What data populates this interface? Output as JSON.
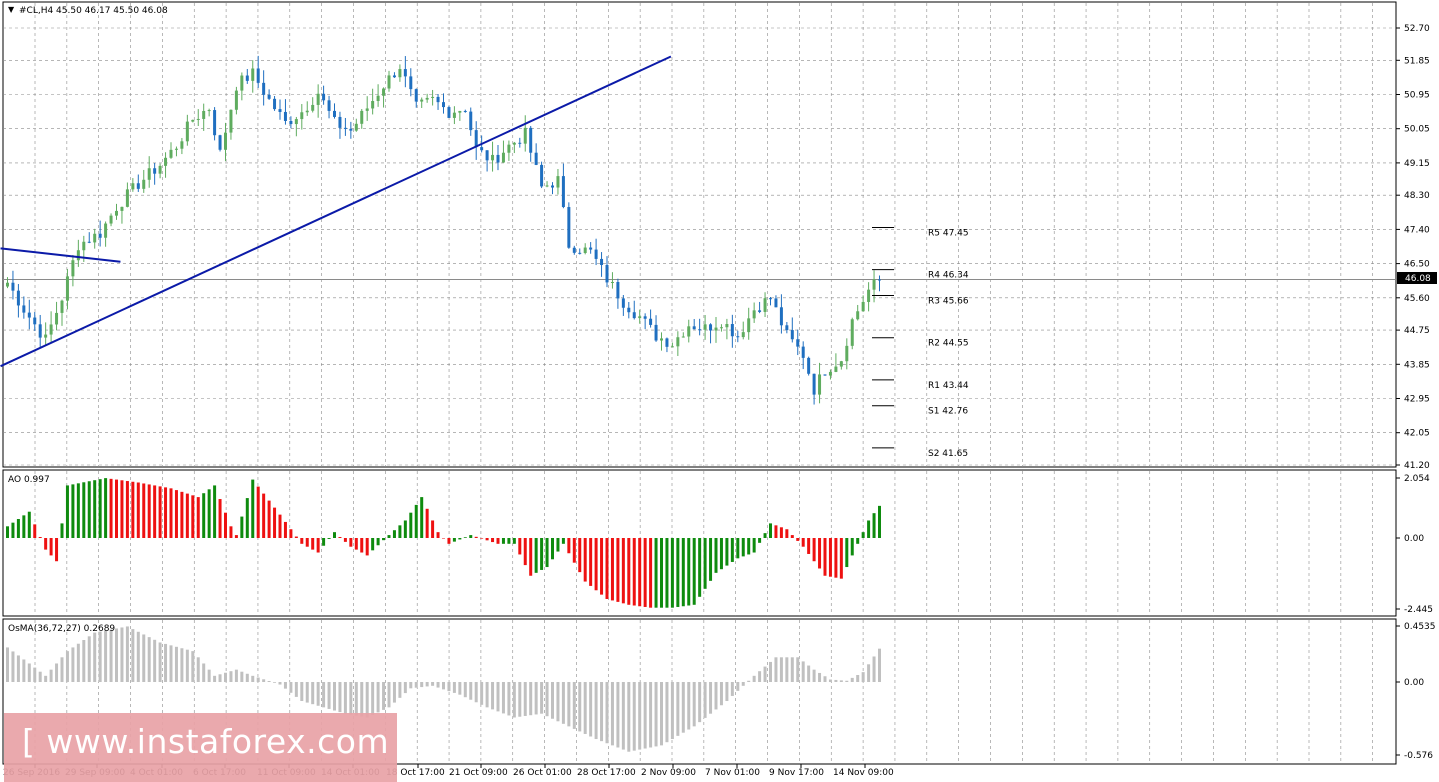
{
  "header": {
    "symbol_line": "#CL,H4  45.50 46.17 45.50 46.08",
    "symbol": "#CL,H4",
    "ohlc": "45.50 46.17 45.50 46.08"
  },
  "colors": {
    "bull": "#5fac5f",
    "bear": "#1f6fc0",
    "trendline": "#0b1aa8",
    "grid": "#8a8a8a",
    "ao_up": "#0e8b0e",
    "ao_down": "#ee1111",
    "osma": "#c0c0c0",
    "watermark_bg": "#e8a2a6"
  },
  "price_axis": {
    "labels": [
      "52.70",
      "51.85",
      "50.95",
      "50.05",
      "49.15",
      "48.30",
      "47.40",
      "46.50",
      "45.60",
      "44.75",
      "43.85",
      "42.95",
      "42.05",
      "41.20"
    ],
    "current_price": "46.08"
  },
  "pivot_levels": [
    {
      "label": "R5 47.45",
      "value": 47.45
    },
    {
      "label": "R4 46.34",
      "value": 46.34
    },
    {
      "label": "R3 45.66",
      "value": 45.66
    },
    {
      "label": "R2 44.55",
      "value": 44.55
    },
    {
      "label": "R1 43.44",
      "value": 43.44
    },
    {
      "label": "S1 42.76",
      "value": 42.76
    },
    {
      "label": "S2 41.65",
      "value": 41.65
    }
  ],
  "time_axis": {
    "labels": [
      "26 Sep 2016",
      "29 Sep 09:00",
      "4 Oct 01:00",
      "6 Oct 17:00",
      "11 Oct 09:00",
      "14 Oct 01:00",
      "18 Oct 17:00",
      "21 Oct 09:00",
      "26 Oct 01:00",
      "28 Oct 17:00",
      "2 Nov 09:00",
      "7 Nov 01:00",
      "9 Nov 17:00",
      "14 Nov 09:00"
    ]
  },
  "ao": {
    "title": "AO 0.997",
    "labels": [
      "2.054",
      "0.00",
      "-2.445"
    ],
    "max": 2.054,
    "min": -2.445
  },
  "osma": {
    "title": "OsMA(36,72,27) 0.2689",
    "labels": [
      "0.4535",
      "0.00",
      "-0.576"
    ],
    "max": 0.4535,
    "min": -0.576
  },
  "watermark": {
    "text": "[ www.instaforex.com ]"
  },
  "chart_data": [
    {
      "type": "candlestick",
      "title": "#CL,H4  45.50 46.17 45.50 46.08",
      "ylim": [
        41.2,
        52.7
      ],
      "x_ticks": [
        "26 Sep 2016",
        "29 Sep 09:00",
        "4 Oct 01:00",
        "6 Oct 17:00",
        "11 Oct 09:00",
        "14 Oct 01:00",
        "18 Oct 17:00",
        "21 Oct 09:00",
        "26 Oct 01:00",
        "28 Oct 17:00",
        "2 Nov 09:00",
        "7 Nov 01:00",
        "9 Nov 17:00",
        "14 Nov 09:00"
      ],
      "close_path": [
        [
          0,
          46.0
        ],
        [
          3,
          45.3
        ],
        [
          7,
          44.5
        ],
        [
          10,
          45.6
        ],
        [
          13,
          47.0
        ],
        [
          17,
          47.3
        ],
        [
          20,
          48.0
        ],
        [
          24,
          48.6
        ],
        [
          28,
          49.1
        ],
        [
          31,
          49.6
        ],
        [
          34,
          50.3
        ],
        [
          37,
          50.6
        ],
        [
          39,
          49.4
        ],
        [
          42,
          51.2
        ],
        [
          45,
          51.5
        ],
        [
          48,
          50.8
        ],
        [
          51,
          50.2
        ],
        [
          54,
          50.5
        ],
        [
          57,
          51.0
        ],
        [
          60,
          50.2
        ],
        [
          63,
          50.0
        ],
        [
          66,
          50.6
        ],
        [
          69,
          51.2
        ],
        [
          72,
          51.7
        ],
        [
          75,
          50.6
        ],
        [
          78,
          50.8
        ],
        [
          81,
          50.5
        ],
        [
          84,
          50.6
        ],
        [
          86,
          49.5
        ],
        [
          89,
          49.2
        ],
        [
          92,
          49.6
        ],
        [
          95,
          49.9
        ],
        [
          98,
          48.5
        ],
        [
          101,
          48.7
        ],
        [
          103,
          47.0
        ],
        [
          107,
          46.8
        ],
        [
          110,
          46.1
        ],
        [
          113,
          45.5
        ],
        [
          116,
          45.1
        ],
        [
          119,
          44.6
        ],
        [
          122,
          44.4
        ],
        [
          125,
          44.9
        ],
        [
          128,
          44.8
        ],
        [
          131,
          45.0
        ],
        [
          134,
          44.6
        ],
        [
          137,
          45.3
        ],
        [
          140,
          45.6
        ],
        [
          143,
          44.6
        ],
        [
          146,
          44.1
        ],
        [
          148,
          43.2
        ],
        [
          150,
          43.7
        ],
        [
          153,
          44.0
        ],
        [
          155,
          45.0
        ],
        [
          158,
          45.8
        ],
        [
          160,
          46.08
        ]
      ],
      "trendlines": [
        {
          "from": [
            -1,
            43.8
          ],
          "to": [
            122,
            51.95
          ]
        },
        {
          "from": [
            -1,
            46.9
          ],
          "to": [
            21,
            46.55
          ]
        }
      ],
      "horizontal_line": 46.08
    },
    {
      "type": "bar",
      "title": "AO 0.997",
      "ylim": [
        -2.445,
        2.054
      ],
      "path": [
        [
          0,
          0.4
        ],
        [
          4,
          0.9
        ],
        [
          7,
          -0.4
        ],
        [
          9,
          -0.8
        ],
        [
          11,
          1.8
        ],
        [
          18,
          2.05
        ],
        [
          24,
          1.9
        ],
        [
          30,
          1.7
        ],
        [
          35,
          1.4
        ],
        [
          38,
          1.8
        ],
        [
          41,
          0.4
        ],
        [
          42,
          0.1
        ],
        [
          45,
          2.0
        ],
        [
          50,
          0.8
        ],
        [
          54,
          -0.2
        ],
        [
          57,
          -0.5
        ],
        [
          60,
          0.2
        ],
        [
          63,
          -0.3
        ],
        [
          66,
          -0.6
        ],
        [
          70,
          0.1
        ],
        [
          73,
          0.6
        ],
        [
          76,
          1.4
        ],
        [
          79,
          0.2
        ],
        [
          81,
          -0.2
        ],
        [
          85,
          0.1
        ],
        [
          90,
          -0.2
        ],
        [
          93,
          -0.2
        ],
        [
          96,
          -1.3
        ],
        [
          99,
          -1.0
        ],
        [
          102,
          -0.2
        ],
        [
          106,
          -1.5
        ],
        [
          110,
          -2.1
        ],
        [
          114,
          -2.3
        ],
        [
          118,
          -2.4
        ],
        [
          122,
          -2.4
        ],
        [
          126,
          -2.3
        ],
        [
          130,
          -1.2
        ],
        [
          134,
          -0.7
        ],
        [
          137,
          -0.5
        ],
        [
          140,
          0.5
        ],
        [
          143,
          0.3
        ],
        [
          146,
          -0.3
        ],
        [
          150,
          -1.3
        ],
        [
          153,
          -1.4
        ],
        [
          156,
          -0.2
        ],
        [
          158,
          0.6
        ],
        [
          160,
          1.1
        ]
      ]
    },
    {
      "type": "bar",
      "title": "OsMA(36,72,27) 0.2689",
      "ylim": [
        -0.576,
        0.4535
      ],
      "path": [
        [
          0,
          0.28
        ],
        [
          4,
          0.15
        ],
        [
          7,
          0.05
        ],
        [
          11,
          0.25
        ],
        [
          16,
          0.4
        ],
        [
          22,
          0.45
        ],
        [
          28,
          0.32
        ],
        [
          34,
          0.25
        ],
        [
          38,
          0.05
        ],
        [
          42,
          0.1
        ],
        [
          45,
          0.05
        ],
        [
          50,
          -0.02
        ],
        [
          54,
          -0.15
        ],
        [
          58,
          -0.2
        ],
        [
          62,
          -0.25
        ],
        [
          66,
          -0.28
        ],
        [
          70,
          -0.2
        ],
        [
          74,
          -0.05
        ],
        [
          78,
          -0.03
        ],
        [
          83,
          -0.1
        ],
        [
          88,
          -0.2
        ],
        [
          93,
          -0.28
        ],
        [
          98,
          -0.25
        ],
        [
          103,
          -0.35
        ],
        [
          108,
          -0.45
        ],
        [
          114,
          -0.55
        ],
        [
          120,
          -0.5
        ],
        [
          126,
          -0.35
        ],
        [
          132,
          -0.15
        ],
        [
          137,
          0.05
        ],
        [
          141,
          0.2
        ],
        [
          145,
          0.2
        ],
        [
          148,
          0.1
        ],
        [
          151,
          0.02
        ],
        [
          154,
          0.01
        ],
        [
          157,
          0.08
        ],
        [
          160,
          0.27
        ]
      ]
    }
  ]
}
